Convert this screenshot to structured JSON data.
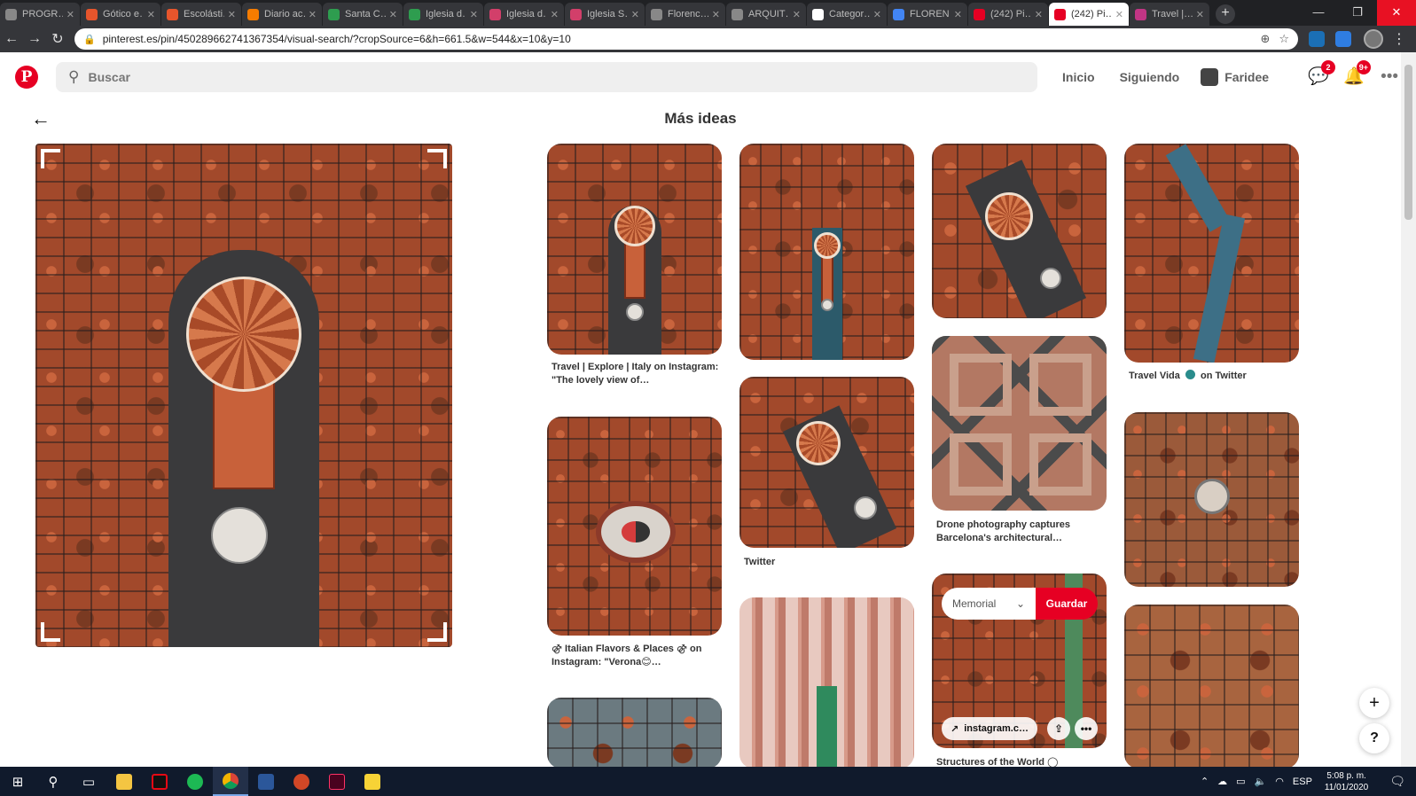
{
  "browser": {
    "tabs": [
      {
        "title": "PROGR…",
        "color": "#888888"
      },
      {
        "title": "Gótico e…",
        "color": "#e7552c"
      },
      {
        "title": "Escolásti…",
        "color": "#e7552c"
      },
      {
        "title": "Diario ac…",
        "color": "#f57c00"
      },
      {
        "title": "Santa C…",
        "color": "#2e9d4f"
      },
      {
        "title": "Iglesia d…",
        "color": "#2e9d4f"
      },
      {
        "title": "Iglesia d…",
        "color": "#d23f6a"
      },
      {
        "title": "Iglesia S…",
        "color": "#d23f6a"
      },
      {
        "title": "Florenc…",
        "color": "#888888"
      },
      {
        "title": "ARQUIT…",
        "color": "#888888"
      },
      {
        "title": "Categor…",
        "color": "#ffffff"
      },
      {
        "title": "FLOREN…",
        "color": "#4285f4"
      },
      {
        "title": "(242) Pi…",
        "color": "#e60023"
      },
      {
        "title": "(242) Pi…",
        "color": "#e60023",
        "active": true
      },
      {
        "title": "Travel |…",
        "color": "#c13584"
      }
    ],
    "url": "pinterest.es/pin/450289662741367354/visual-search/?cropSource=6&h=661.5&w=544&x=10&y=10"
  },
  "header": {
    "search_placeholder": "Buscar",
    "nav_home": "Inicio",
    "nav_following": "Siguiendo",
    "user_name": "Faridee",
    "messages_badge": "2",
    "notifications_badge": "9+"
  },
  "content": {
    "section_title": "Más ideas",
    "captions": {
      "p1": "Travel | Explore | Italy on Instagram: \"The lovely view of…",
      "p2": "⚣ Italian Flavors & Places ⚣ on Instagram: \"Verona😊…",
      "p4": "Twitter",
      "p7": "Drone photography captures Barcelona's architectural…",
      "p8": "Structures of the World ◯",
      "p9_pre": "Travel Vida",
      "p9_post": "on Twitter"
    },
    "hover_pin": {
      "board": "Memorial",
      "save_label": "Guardar",
      "link_label": "instagram.c…"
    }
  },
  "taskbar": {
    "lang": "ESP",
    "time": "5:08 p. m.",
    "date": "11/01/2020"
  },
  "colors": {
    "brand": "#e60023",
    "tile": "#a2492b"
  }
}
